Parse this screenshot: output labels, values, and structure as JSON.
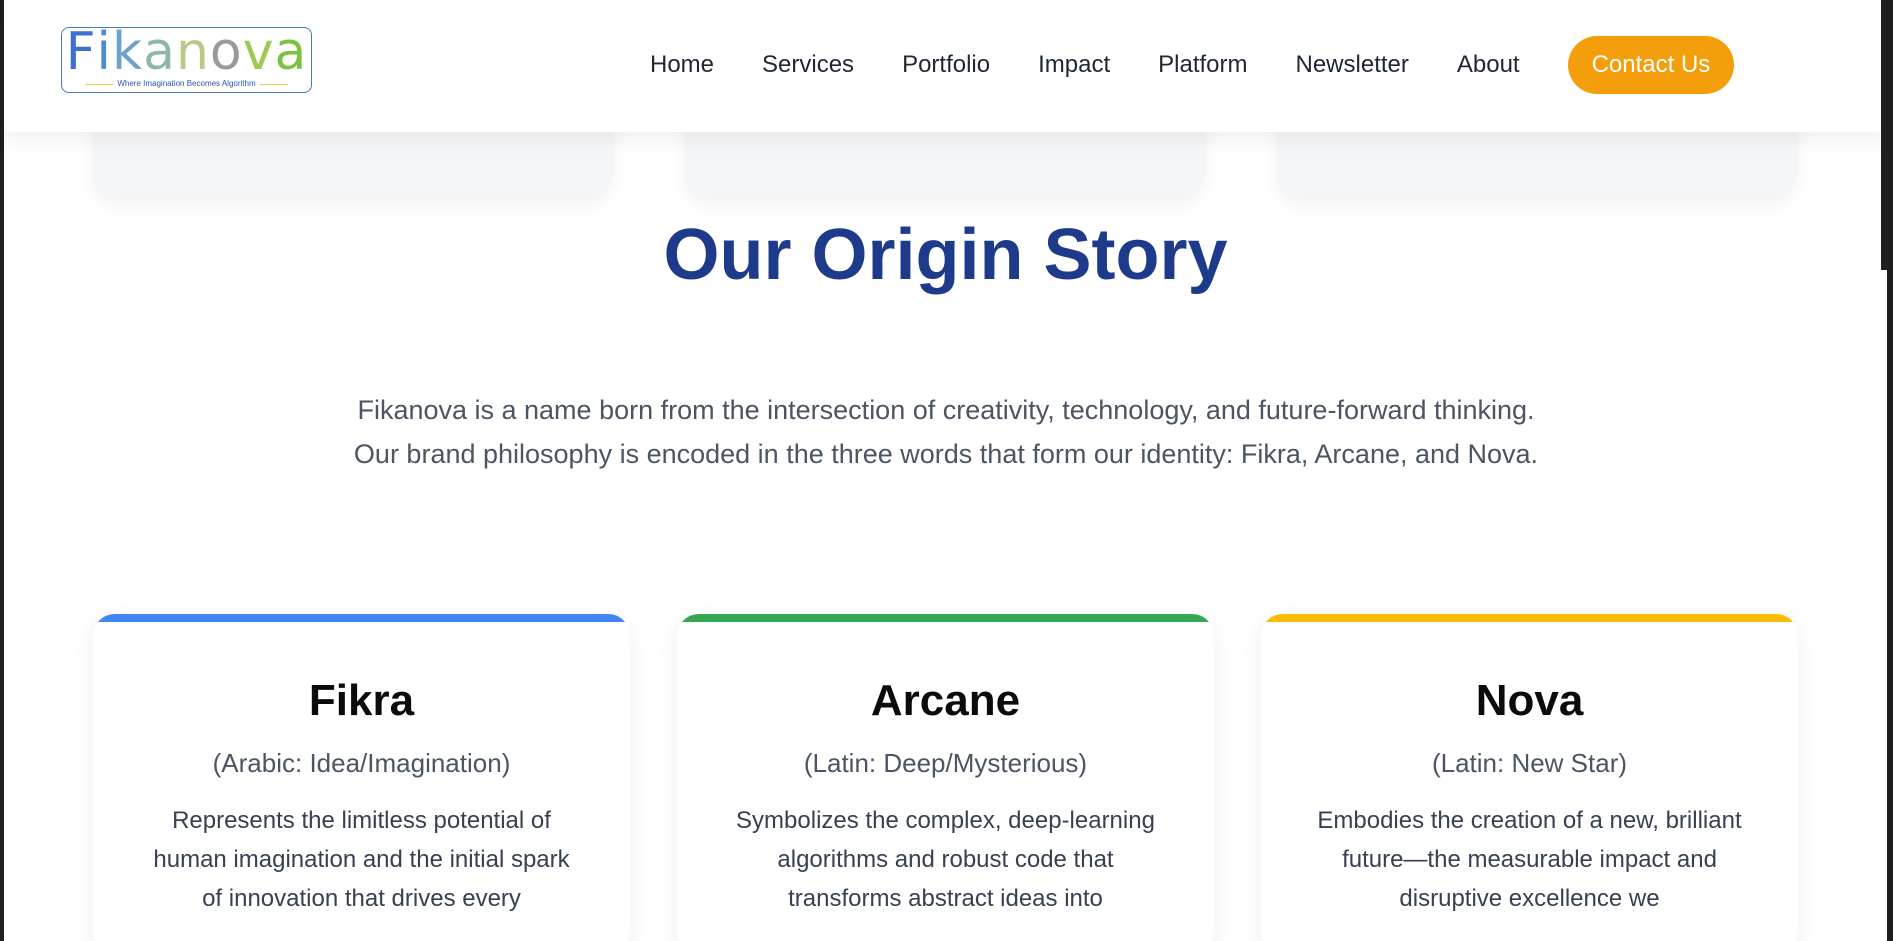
{
  "brand": {
    "logo_letters": [
      {
        "ch": "F",
        "color": "#3d6fd6"
      },
      {
        "ch": "i",
        "color": "#4b8ad4"
      },
      {
        "ch": "k",
        "color": "#6fa0cf"
      },
      {
        "ch": "a",
        "color": "#8fb7a8"
      },
      {
        "ch": "n",
        "color": "#b9c98a"
      },
      {
        "ch": "o",
        "color": "#9a9a9a"
      },
      {
        "ch": "v",
        "color": "#9ccb52"
      },
      {
        "ch": "a",
        "color": "#7cc241"
      }
    ],
    "tagline": "Where Imagination Becomes Algorithm"
  },
  "nav": {
    "items": [
      "Home",
      "Services",
      "Portfolio",
      "Impact",
      "Platform",
      "Newsletter",
      "About"
    ],
    "contact_label": "Contact Us",
    "contact_color": "#f59e0b"
  },
  "origin": {
    "title": "Our Origin Story",
    "intro": "Fikanova is a name born from the intersection of creativity, technology, and future-forward thinking. Our brand philosophy is encoded in the three words that form our identity: Fikra, Arcane, and Nova.",
    "cards": [
      {
        "title": "Fikra",
        "origin": "(Arabic: Idea/Imagination)",
        "desc": "Represents the limitless potential of human imagination and the initial spark of innovation that drives every",
        "accent": "#4285f4"
      },
      {
        "title": "Arcane",
        "origin": "(Latin: Deep/Mysterious)",
        "desc": "Symbolizes the complex, deep-learning algorithms and robust code that transforms abstract ideas into",
        "accent": "#34a853"
      },
      {
        "title": "Nova",
        "origin": "(Latin: New Star)",
        "desc": "Embodies the creation of a new, brilliant future—the measurable impact and disruptive excellence we",
        "accent": "#fbbc05"
      }
    ]
  }
}
